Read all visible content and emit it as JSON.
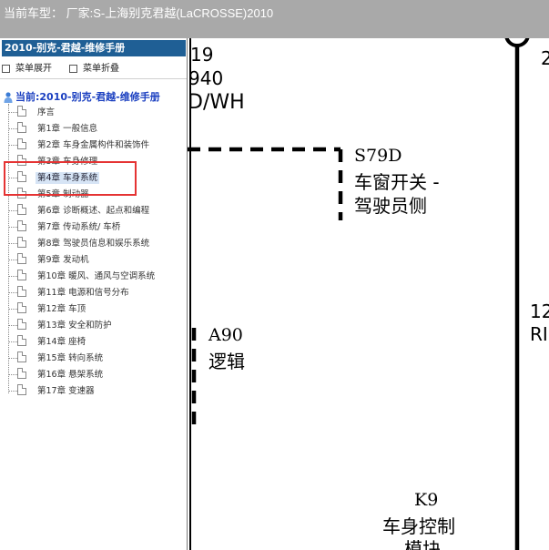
{
  "window": {
    "title": "当前车型： 厂家:S-上海别克君越(LaCROSSE)2010"
  },
  "sidebar": {
    "header": "2010-别克-君越-维修手册",
    "menu": {
      "expand_label": "菜单展开",
      "collapse_label": "菜单折叠"
    },
    "tree_root": "当前:2010-别克-君越-维修手册",
    "items": [
      {
        "label": "序言"
      },
      {
        "label": "第1章 一般信息"
      },
      {
        "label": "第2章 车身金属构件和装饰件"
      },
      {
        "label": "第3章 车身修理"
      },
      {
        "label": "第4章 车身系统",
        "selected": true
      },
      {
        "label": "第5章 制动器"
      },
      {
        "label": "第6章 诊断概述、起点和编程"
      },
      {
        "label": "第7章 传动系统/ 车桥"
      },
      {
        "label": "第8章 驾驶员信息和娱乐系统"
      },
      {
        "label": "第9章 发动机"
      },
      {
        "label": "第10章 暖风、通风与空调系统"
      },
      {
        "label": "第11章 电源和信号分布"
      },
      {
        "label": "第12章 车顶"
      },
      {
        "label": "第13章 安全和防护"
      },
      {
        "label": "第14章 座椅"
      },
      {
        "label": "第15章 转向系统"
      },
      {
        "label": "第16章 悬架系统"
      },
      {
        "label": "第17章 变速器"
      }
    ]
  },
  "diagram": {
    "wire_num": "19",
    "wire_code": "940",
    "wire_color": "D/WH",
    "component_id": "S79D",
    "component_name_1": "车窗开关 -",
    "component_name_2": "驾驶员侧",
    "logic_id": "A90",
    "logic_name": "逻辑",
    "module_id": "K9",
    "module_name_1": "车身控制",
    "module_name_2": "模块",
    "right_edge_num": "12",
    "right_edge_code": "RI",
    "top_right_mark": "2"
  }
}
